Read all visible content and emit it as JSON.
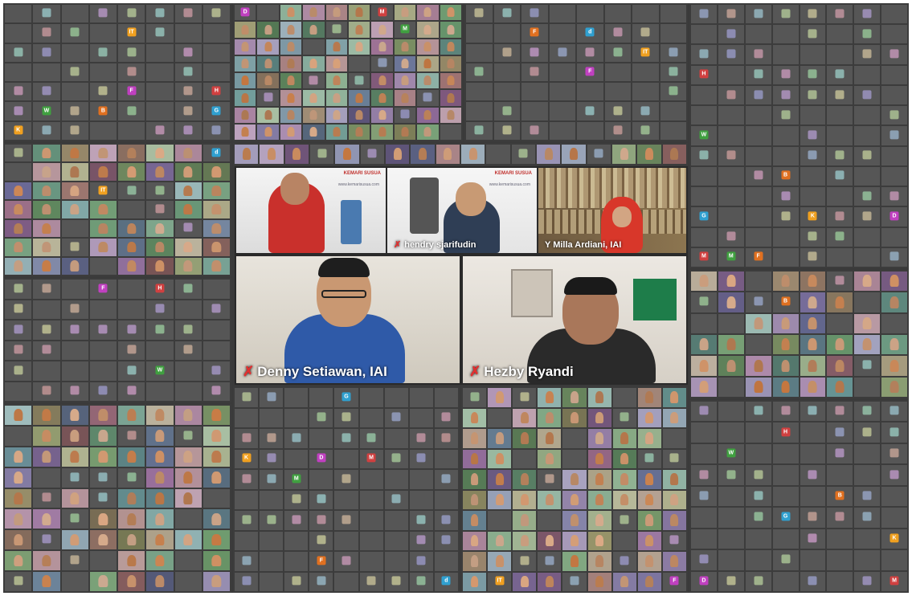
{
  "meeting": {
    "speakers": [
      {
        "name": "",
        "logo": "KEMARI SUSUA",
        "url": "www.kemarisusua.com"
      },
      {
        "name": "hendry sjarifudin",
        "logo": "KEMARI SUSUA",
        "url": "www.kemarisusua.com"
      },
      {
        "name": "Y Milla Ardiani, IAI",
        "logo": "",
        "url": ""
      },
      {
        "name": "Denny Setiawan, IAI",
        "logo": "",
        "url": ""
      },
      {
        "name": "Hezby Ryandi",
        "logo": "",
        "url": ""
      }
    ],
    "initial_tiles": [
      "IT",
      "F",
      "H",
      "W",
      "B",
      "G",
      "K",
      "D",
      "M",
      "M",
      "F",
      "d"
    ],
    "colors": {
      "accent_red": "#e03030",
      "grid_bg": "#3a3a3a",
      "tile_bg": "#565656"
    }
  }
}
